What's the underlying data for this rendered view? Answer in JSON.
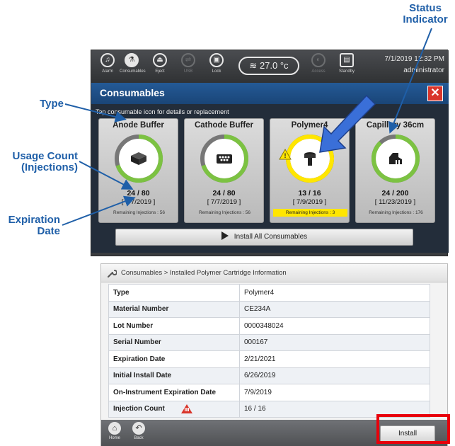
{
  "callouts": {
    "status_indicator": [
      "Status",
      "Indicator"
    ],
    "type": "Type",
    "usage_count": [
      "Usage Count",
      "(Injections)"
    ],
    "expiration_date": [
      "Expiration",
      "Date"
    ]
  },
  "toolbar": {
    "items": [
      {
        "label": "Alarm",
        "icon": "alarm-bell-icon",
        "active": false,
        "enabled": true
      },
      {
        "label": "Consumables",
        "icon": "flask-icon",
        "active": true,
        "enabled": true
      },
      {
        "label": "Eject",
        "icon": "eject-icon",
        "active": false,
        "enabled": true
      },
      {
        "label": "USB",
        "icon": "usb-icon",
        "active": false,
        "enabled": false
      },
      {
        "label": "Lock",
        "icon": "lock-icon",
        "active": false,
        "enabled": true
      },
      {
        "label": "Access",
        "icon": "access-icon",
        "active": false,
        "enabled": false
      },
      {
        "label": "Standby",
        "icon": "standby-icon",
        "active": false,
        "enabled": true
      }
    ],
    "temperature": "27.0 °c",
    "datetime": "7/1/2019 12:32 PM",
    "user": "administrator"
  },
  "consumables_panel": {
    "title": "Consumables",
    "hint": "Tap consumable icon for details or replacement",
    "cards": [
      {
        "title": "Anode Buffer",
        "count": "24 / 80",
        "date": "[ 7/7/2019 ]",
        "remaining": "Remaining Injections : 56",
        "status_fraction": 0.7,
        "status_color": "#7cc242",
        "warning": false,
        "icon": "anode-buffer-icon"
      },
      {
        "title": "Cathode Buffer",
        "count": "24 / 80",
        "date": "[ 7/7/2019 ]",
        "remaining": "Remaining Injections : 56",
        "status_fraction": 0.7,
        "status_color": "#7cc242",
        "warning": false,
        "icon": "cathode-buffer-icon"
      },
      {
        "title": "Polymer4",
        "count": "13 / 16",
        "date": "[ 7/9/2019 ]",
        "remaining": "Remaining Injections : 3",
        "status_fraction": 1.0,
        "status_color": "#ffe600",
        "warning": true,
        "icon": "polymer-cartridge-icon"
      },
      {
        "title": "Capillary 36cm",
        "count": "24 / 200",
        "date": "[ 11/23/2019 ]",
        "remaining": "Remaining Injections : 176",
        "status_fraction": 0.88,
        "status_color": "#7cc242",
        "warning": false,
        "icon": "capillary-array-icon"
      }
    ],
    "install_all_label": "Install All Consumables"
  },
  "info_screen": {
    "breadcrumb": "Consumables > Installed Polymer Cartridge Information",
    "rows": [
      {
        "key": "Type",
        "value": "Polymer4"
      },
      {
        "key": "Material Number",
        "value": "CE234A"
      },
      {
        "key": "Lot Number",
        "value": "0000348024"
      },
      {
        "key": "Serial Number",
        "value": "000167"
      },
      {
        "key": "Expiration Date",
        "value": "2/21/2021"
      },
      {
        "key": "Initial Install Date",
        "value": "6/26/2019"
      },
      {
        "key": "On-Instrument Expiration Date",
        "value": "7/9/2019"
      },
      {
        "key": "Injection Count",
        "value": "16 / 16"
      }
    ],
    "footer": {
      "home_label": "Home",
      "back_label": "Back",
      "install_label": "Install"
    }
  },
  "colors": {
    "callout": "#1f5fa8",
    "highlight": "#e8000b",
    "ok": "#7cc242",
    "warn": "#ffe600",
    "alert": "#d9352b"
  }
}
